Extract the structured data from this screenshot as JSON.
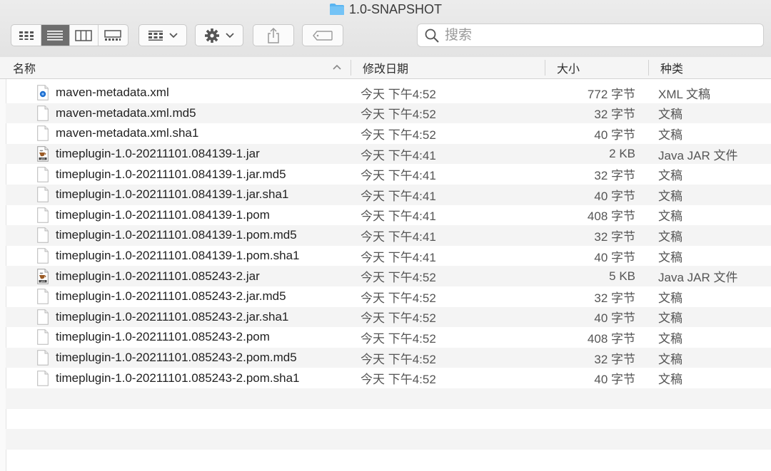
{
  "window": {
    "title": "1.0-SNAPSHOT"
  },
  "toolbar": {
    "view_modes": [
      "icon-view",
      "list-view",
      "column-view",
      "gallery-view"
    ],
    "active_view": "list-view",
    "arrange_icon": "group-grid-icon",
    "action_icon": "gear-icon",
    "share_icon": "share-icon",
    "tag_icon": "tag-icon"
  },
  "search": {
    "placeholder": "搜索"
  },
  "columns": {
    "name": "名称",
    "modified": "修改日期",
    "size": "大小",
    "kind": "种类"
  },
  "files": [
    {
      "icon": "xml-file-icon",
      "name": "maven-metadata.xml",
      "modified": "今天 下午4:52",
      "size": "772 字节",
      "kind": "XML 文稿"
    },
    {
      "icon": "document-icon",
      "name": "maven-metadata.xml.md5",
      "modified": "今天 下午4:52",
      "size": "32 字节",
      "kind": "文稿"
    },
    {
      "icon": "document-icon",
      "name": "maven-metadata.xml.sha1",
      "modified": "今天 下午4:52",
      "size": "40 字节",
      "kind": "文稿"
    },
    {
      "icon": "jar-file-icon",
      "name": "timeplugin-1.0-20211101.084139-1.jar",
      "modified": "今天 下午4:41",
      "size": "2 KB",
      "kind": "Java JAR 文件"
    },
    {
      "icon": "document-icon",
      "name": "timeplugin-1.0-20211101.084139-1.jar.md5",
      "modified": "今天 下午4:41",
      "size": "32 字节",
      "kind": "文稿"
    },
    {
      "icon": "document-icon",
      "name": "timeplugin-1.0-20211101.084139-1.jar.sha1",
      "modified": "今天 下午4:41",
      "size": "40 字节",
      "kind": "文稿"
    },
    {
      "icon": "document-icon",
      "name": "timeplugin-1.0-20211101.084139-1.pom",
      "modified": "今天 下午4:41",
      "size": "408 字节",
      "kind": "文稿"
    },
    {
      "icon": "document-icon",
      "name": "timeplugin-1.0-20211101.084139-1.pom.md5",
      "modified": "今天 下午4:41",
      "size": "32 字节",
      "kind": "文稿"
    },
    {
      "icon": "document-icon",
      "name": "timeplugin-1.0-20211101.084139-1.pom.sha1",
      "modified": "今天 下午4:41",
      "size": "40 字节",
      "kind": "文稿"
    },
    {
      "icon": "jar-file-icon",
      "name": "timeplugin-1.0-20211101.085243-2.jar",
      "modified": "今天 下午4:52",
      "size": "5 KB",
      "kind": "Java JAR 文件"
    },
    {
      "icon": "document-icon",
      "name": "timeplugin-1.0-20211101.085243-2.jar.md5",
      "modified": "今天 下午4:52",
      "size": "32 字节",
      "kind": "文稿"
    },
    {
      "icon": "document-icon",
      "name": "timeplugin-1.0-20211101.085243-2.jar.sha1",
      "modified": "今天 下午4:52",
      "size": "40 字节",
      "kind": "文稿"
    },
    {
      "icon": "document-icon",
      "name": "timeplugin-1.0-20211101.085243-2.pom",
      "modified": "今天 下午4:52",
      "size": "408 字节",
      "kind": "文稿"
    },
    {
      "icon": "document-icon",
      "name": "timeplugin-1.0-20211101.085243-2.pom.md5",
      "modified": "今天 下午4:52",
      "size": "32 字节",
      "kind": "文稿"
    },
    {
      "icon": "document-icon",
      "name": "timeplugin-1.0-20211101.085243-2.pom.sha1",
      "modified": "今天 下午4:52",
      "size": "40 字节",
      "kind": "文稿"
    }
  ],
  "colors": {
    "folder": "#5ab4f0",
    "active_segment": "#6e6e6e",
    "row_alt": "#f4f4f4"
  }
}
